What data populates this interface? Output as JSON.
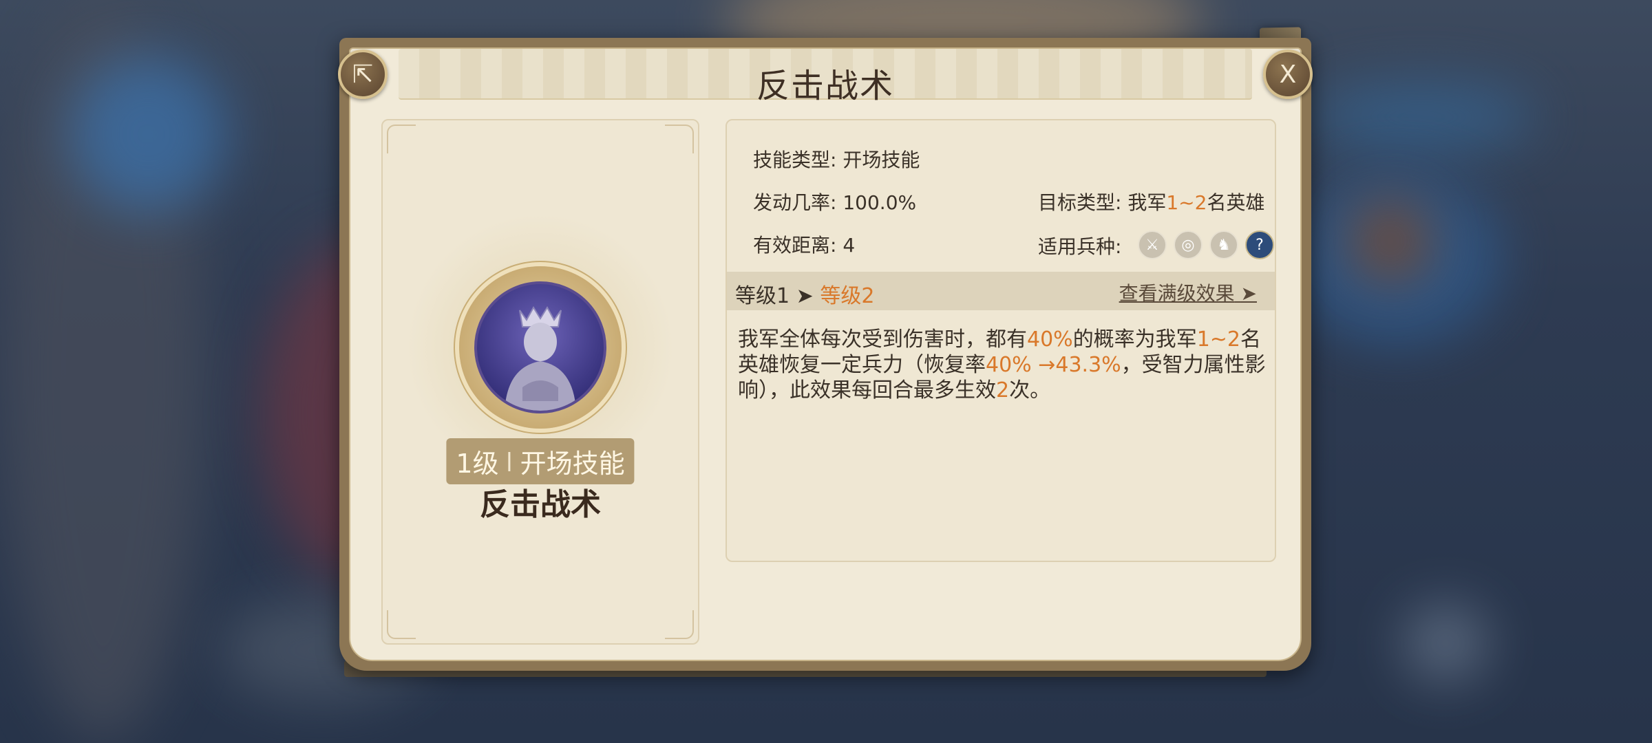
{
  "dialog": {
    "title": "反击战术",
    "share_icon": "⇱",
    "close_label": "X"
  },
  "skill_card": {
    "level": "1级",
    "kind": "开场技能",
    "name": "反击战术"
  },
  "info": {
    "skill_type_label": "技能类型:",
    "skill_type_value": "开场技能",
    "trigger_rate_label": "发动几率:",
    "trigger_rate_value": "100.0%",
    "range_label": "有效距离:",
    "range_value": "4",
    "target_label": "目标类型:",
    "target_prefix": "我军",
    "target_highlight": "1~2",
    "target_suffix": "名英雄",
    "troops_label": "适用兵种:",
    "troop_icons": [
      "sword-icon",
      "target-icon",
      "horse-icon",
      "question-icon"
    ]
  },
  "level_bar": {
    "current": "等级1",
    "arrow": "➤",
    "next": "等级2",
    "full_effect": "查看满级效果",
    "full_effect_arrow": "➤"
  },
  "description": {
    "p1": "我军全体每次受到伤害时，都有",
    "h1": "40%",
    "p2": "的概率为我军",
    "h2": "1~2",
    "p3": "名英雄恢复一定兵力（恢复率",
    "h3": "40% →43.3%",
    "p4": "，受智力属性影响），此效果每回合最多生效",
    "h4": "2",
    "p5": "次。"
  },
  "colors": {
    "highlight": "#d9782a",
    "frame": "#8c7654",
    "parchment": "#f1ead8"
  }
}
